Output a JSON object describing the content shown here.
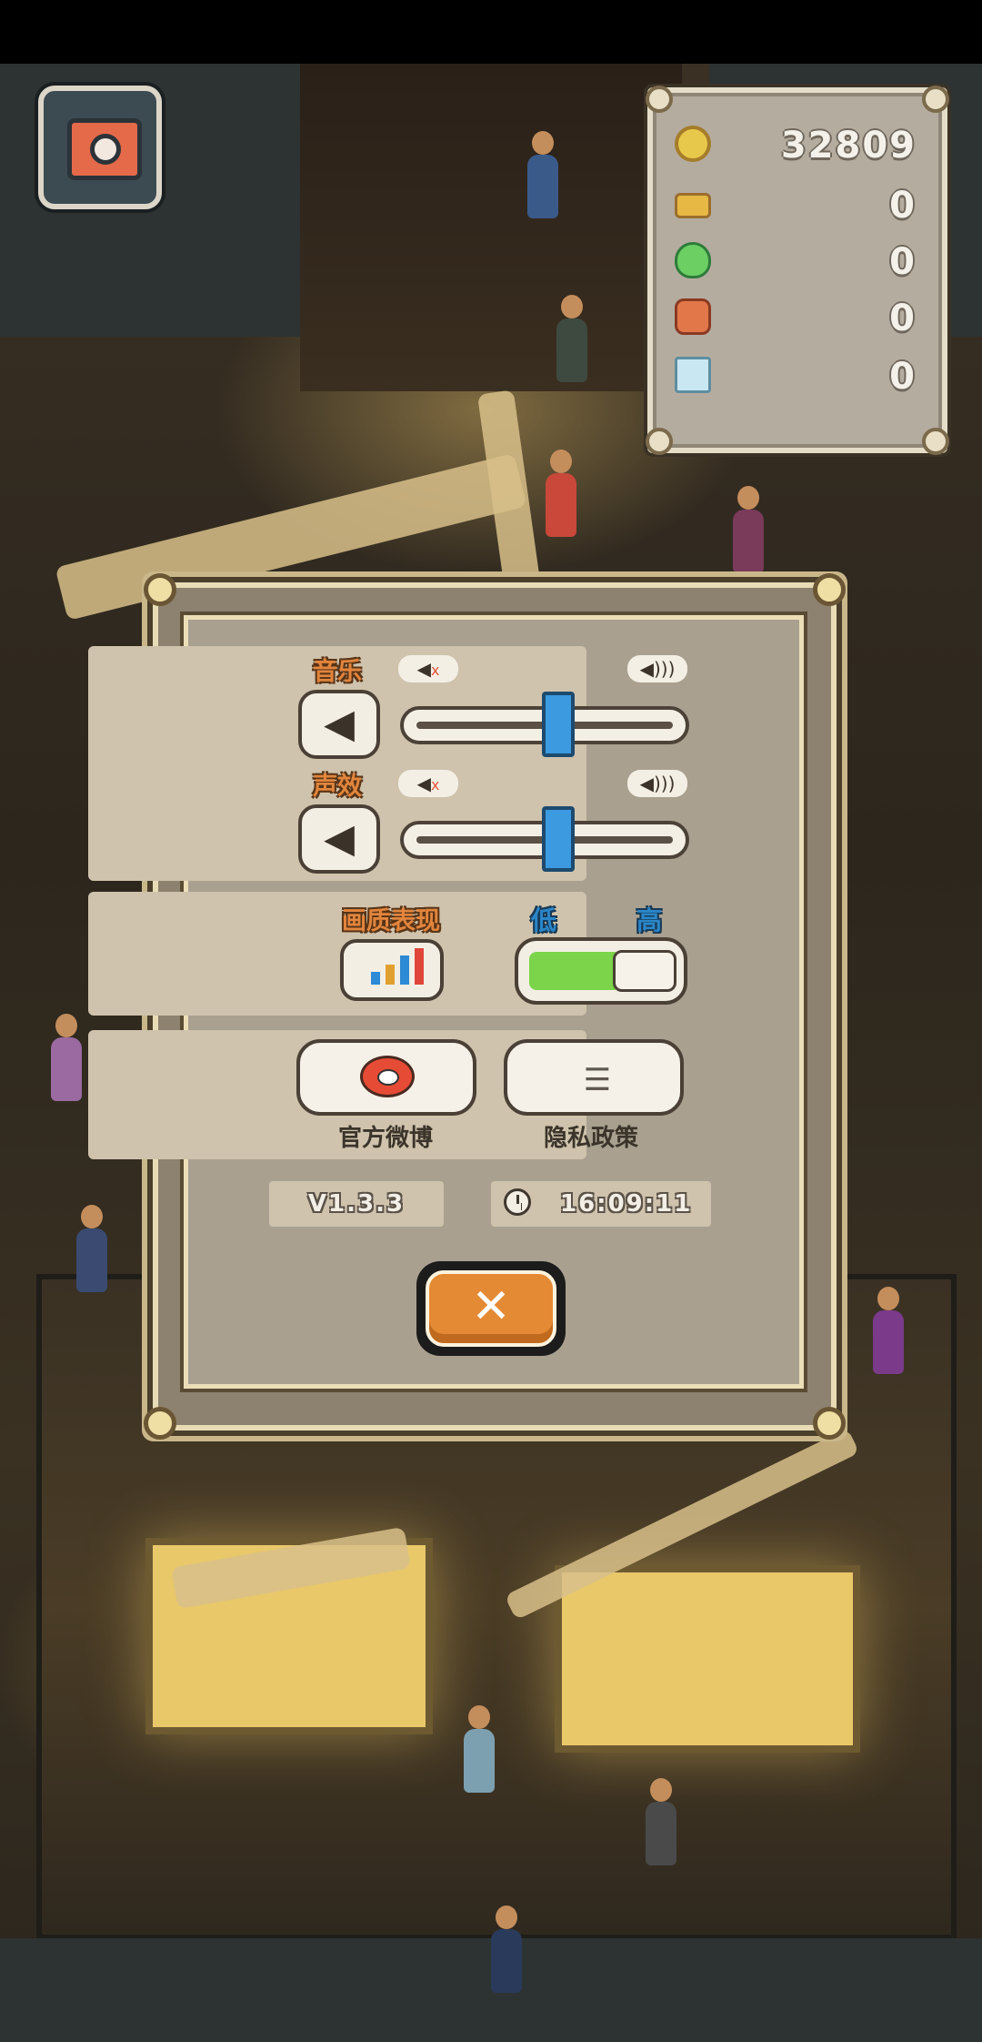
{
  "resources": {
    "coins": "32809",
    "vehicles": "0",
    "potions": "0",
    "bags": "0",
    "tickets": "0"
  },
  "settings": {
    "music_label": "音乐",
    "sfx_label": "声效",
    "music_level": 0.55,
    "sfx_level": 0.55,
    "graphics_label": "画质表现",
    "quality_low": "低",
    "quality_high": "高",
    "quality_level": 0.5,
    "weibo_label": "官方微博",
    "privacy_label": "隐私政策",
    "version": "V1.3.3",
    "time": "16:09:11"
  },
  "icons": {
    "camera": "camera-icon",
    "mute": "speaker-mute-icon",
    "loud": "speaker-loud-icon",
    "close": "close-icon"
  },
  "colors": {
    "accent_orange": "#e58a34",
    "slider_blue": "#3b9ae0",
    "toggle_green": "#7bd44a"
  }
}
